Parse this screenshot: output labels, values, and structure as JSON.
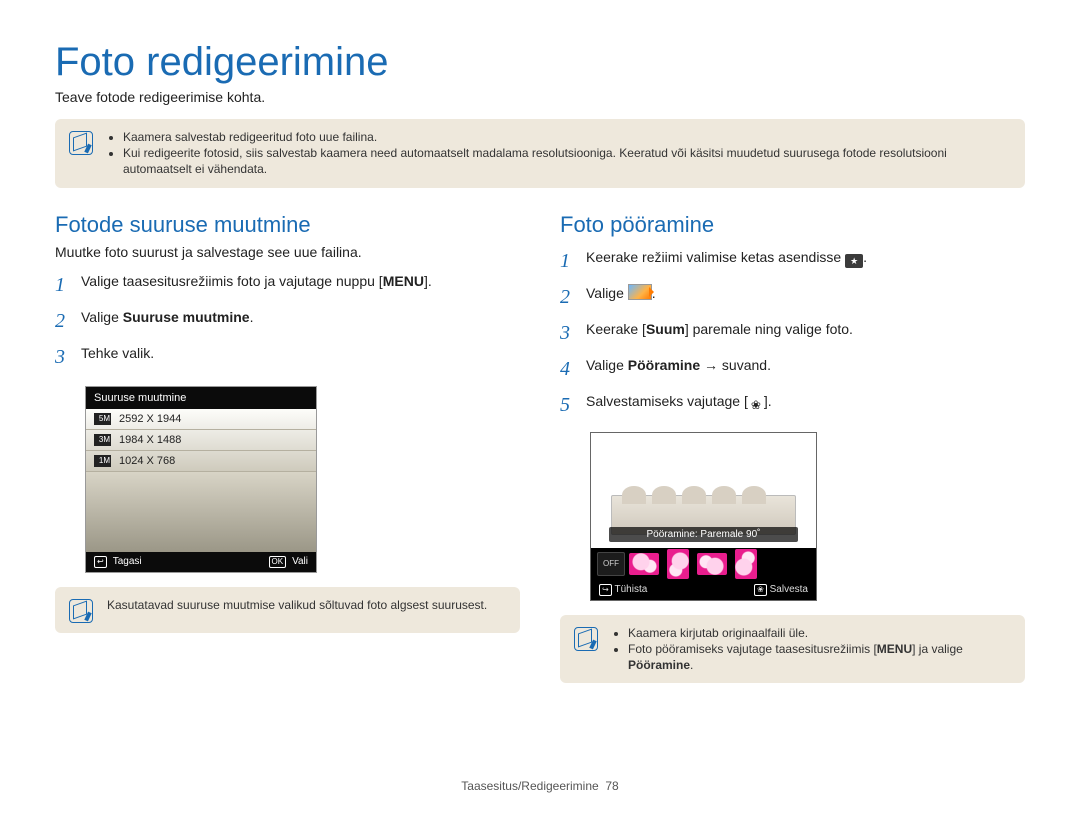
{
  "title": "Foto redigeerimine",
  "lead": "Teave fotode redigeerimise kohta.",
  "top_tip": {
    "bullets": [
      "Kaamera salvestab redigeeritud foto uue failina.",
      "Kui redigeerite fotosid, siis salvestab kaamera need automaatselt madalama resolutsiooniga. Keeratud või käsitsi muudetud suurusega fotode resolutsiooni automaatselt ei vähendata."
    ]
  },
  "left": {
    "heading": "Fotode suuruse muutmine",
    "sub": "Muutke foto suurust ja salvestage see uue failina.",
    "steps": {
      "s1a": "Valige taasesitusrežiimis foto ja vajutage nuppu [",
      "s1b": "MENU",
      "s1c": "].",
      "s2a": "Valige ",
      "s2b": "Suuruse muutmine",
      "s2c": ".",
      "s3": "Tehke valik."
    },
    "lcd": {
      "title": "Suuruse muutmine",
      "options": [
        {
          "badge": "5M",
          "label": "2592 X 1944"
        },
        {
          "badge": "3M",
          "label": "1984 X 1488"
        },
        {
          "badge": "1M",
          "label": "1024 X 768"
        }
      ],
      "back_key": "↩",
      "back": "Tagasi",
      "ok_key": "OK",
      "ok": "Vali"
    },
    "bottom_tip": "Kasutatavad suuruse muutmise valikud sõltuvad foto algsest suurusest."
  },
  "right": {
    "heading": "Foto pööramine",
    "steps": {
      "s1a": "Keerake režiimi valimise ketas asendisse ",
      "s1_icon": "★",
      "s1b": ".",
      "s2a": "Valige ",
      "s2b": ".",
      "s3a": "Keerake [",
      "s3b": "Suum",
      "s3c": "] paremale ning valige foto.",
      "s4a": "Valige ",
      "s4b": "Pööramine",
      "s4c": " → suvand.",
      "s5a": "Salvestamiseks vajutage [",
      "s5_icon": "❀",
      "s5b": "]."
    },
    "lcd": {
      "label": "Pööramine: Paremale 90˚",
      "off": "OFF",
      "cancel_key": "↩",
      "cancel": "Tühista",
      "save_key": "❀",
      "save": "Salvesta"
    },
    "bottom_tip": {
      "b1": "Kaamera kirjutab originaalfaili üle.",
      "b2a": "Foto pööramiseks vajutage taasesitusrežiimis [",
      "b2b": "MENU",
      "b2c": "] ja valige ",
      "b2d": "Pööramine",
      "b2e": "."
    }
  },
  "footer": {
    "section": "Taasesitus/Redigeerimine",
    "page": "78"
  }
}
